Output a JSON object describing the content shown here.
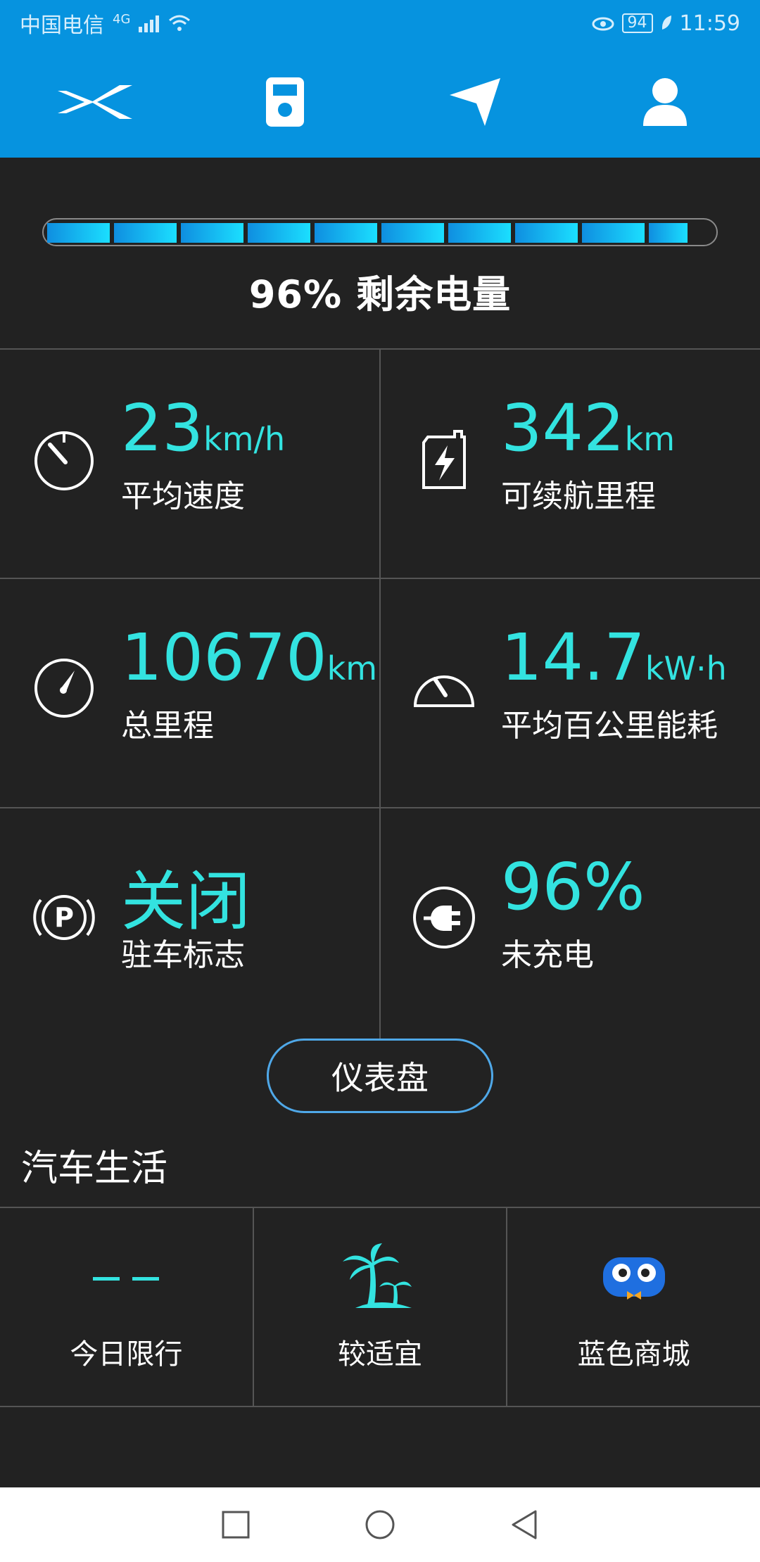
{
  "status_bar": {
    "carrier": "中国电信",
    "network": "4G",
    "battery_level": "94",
    "time": "11:59"
  },
  "top_nav": {
    "items": [
      "xpeng-logo-icon",
      "car-key-icon",
      "navigation-arrow-icon",
      "profile-icon"
    ]
  },
  "battery": {
    "level_fraction": 0.96,
    "percent_text": "96%",
    "label": "剩余电量"
  },
  "stats": [
    {
      "value": "23",
      "unit": "km/h",
      "label": "平均速度",
      "icon": "stopwatch-icon"
    },
    {
      "value": "342",
      "unit": "km",
      "label": "可续航里程",
      "icon": "battery-charge-icon"
    },
    {
      "value": "10670",
      "unit": "km",
      "label": "总里程",
      "icon": "speedometer-icon"
    },
    {
      "value": "14.7",
      "unit": "kW·h",
      "label": "平均百公里能耗",
      "icon": "gauge-icon"
    },
    {
      "value": "关闭",
      "unit": "",
      "label": "驻车标志",
      "icon": "parking-brake-icon"
    },
    {
      "value": "96%",
      "unit": "",
      "label": "未充电",
      "icon": "plug-icon"
    }
  ],
  "dashboard_button": "仪表盘",
  "car_life": {
    "title": "汽车生活",
    "items": [
      {
        "label": "今日限行",
        "icon": "dash-placeholder-icon"
      },
      {
        "label": "较适宜",
        "icon": "palm-tree-icon"
      },
      {
        "label": "蓝色商城",
        "icon": "mascot-icon"
      }
    ]
  },
  "colors": {
    "header_blue": "#0693df",
    "background": "#222222",
    "accent_cyan": "#33e3e0",
    "button_border": "#4fa8e8"
  }
}
